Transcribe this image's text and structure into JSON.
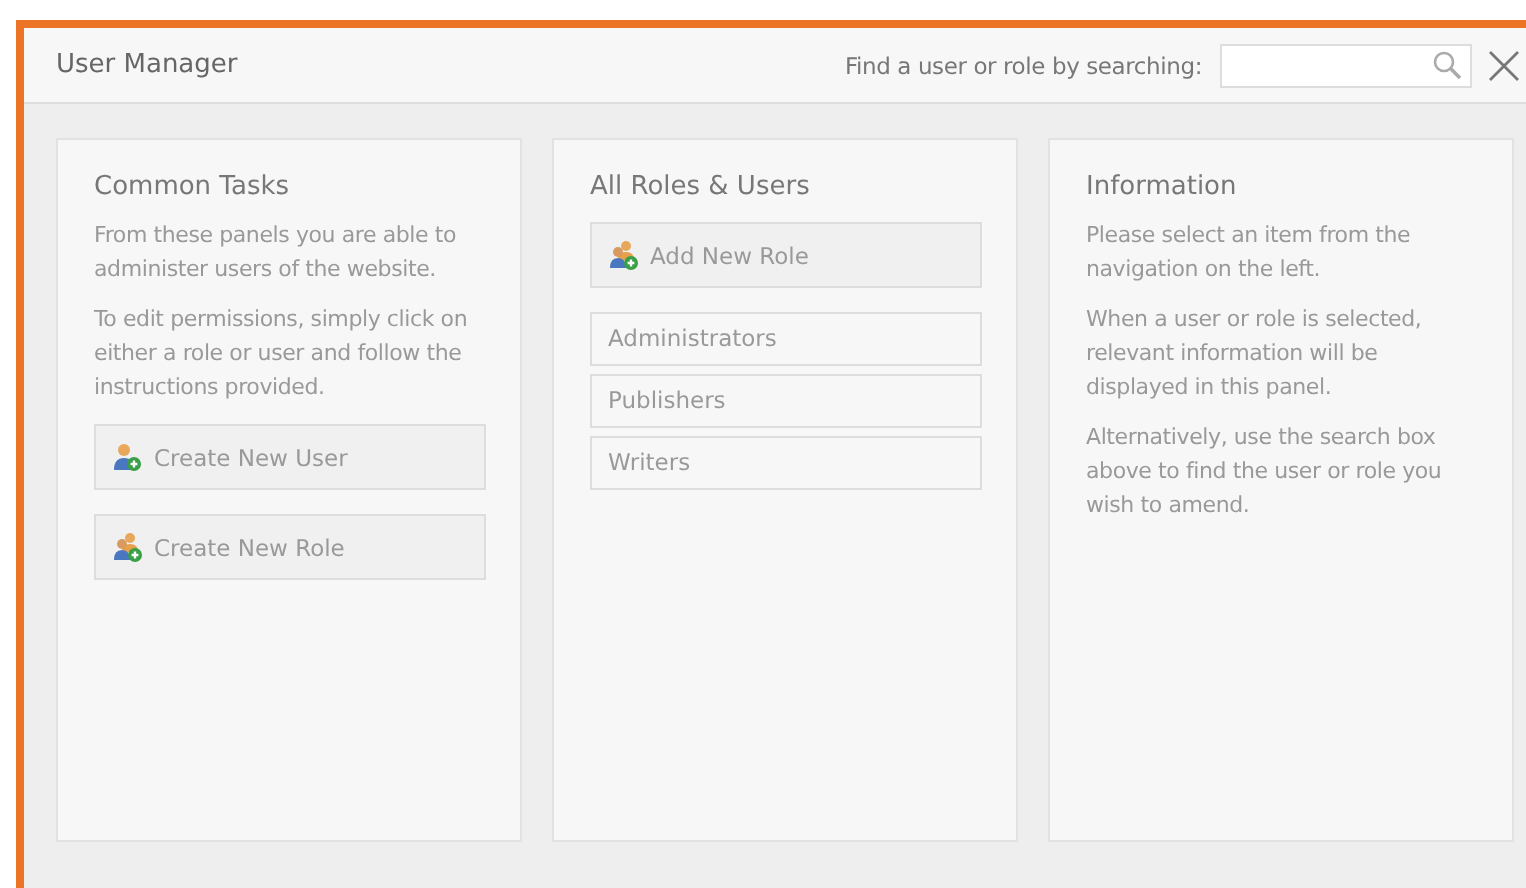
{
  "window": {
    "title": "User Manager"
  },
  "search": {
    "label": "Find a user or role by searching:"
  },
  "panels": [
    {
      "heading": "Common Tasks",
      "paragraphs": [
        "From these panels you are able to administer users of the website.",
        "To edit permissions, simply click on either a role or user and follow the instructions provided."
      ],
      "buttons": [
        {
          "label": "Create New User",
          "kind": "user"
        },
        {
          "label": "Create New Role",
          "kind": "role"
        }
      ]
    },
    {
      "heading": "All Roles & Users",
      "buttons": [
        {
          "label": "Add New Role",
          "kind": "role"
        }
      ],
      "items": [
        "Administrators",
        "Publishers",
        "Writers"
      ]
    },
    {
      "heading": "Information",
      "paragraphs": [
        "Please select an item from the navigation on the left.",
        "When a user or role is selected, relevant information will be displayed in this panel.",
        "Alternatively, use the search box above to find the user or role you wish to amend."
      ]
    }
  ]
}
